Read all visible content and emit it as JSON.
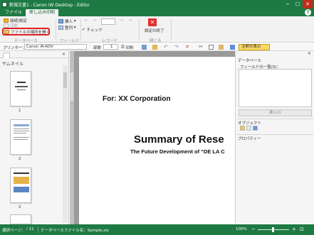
{
  "window": {
    "title": "新規文書1 - Canon iW Desktop - Editor",
    "controls": [
      "─",
      "☐",
      "✕"
    ]
  },
  "ribbon_tabs": [
    {
      "label": "ファイル",
      "active": false
    },
    {
      "label": "差し込み印刷",
      "active": true
    }
  ],
  "ribbon": {
    "connect_label": "接続/設定",
    "print_label": "印刷",
    "open_file_location_label": "ファイルの場所を開く",
    "group_dataset_label": "データベース",
    "insert_label": "挿入",
    "delete_label": "整列",
    "group_field_label": "フィールド",
    "check_label": "チェック",
    "group_record_label": "レコード",
    "close_settings_label": "設定の終了",
    "group_close_label": "閉じる"
  },
  "toolbar2": {
    "printer_label": "プリンター：",
    "printer_value": "Canon iR-ADV",
    "copies_label": "部数",
    "copies_value": "1",
    "print_button_label": "印刷",
    "properties_button_label": "注釈の表示"
  },
  "left_pane": {
    "tab_label": "サムネイル",
    "thumbnails": [
      {
        "number": "1"
      },
      {
        "number": "2"
      },
      {
        "number": "2"
      }
    ]
  },
  "document": {
    "company": "For: XX Corporation",
    "title": "Summary of Rese",
    "subtitle": "The Future Development of “DE LA C"
  },
  "right_pane": {
    "database_label": "データベース",
    "field_list_label": "フィールドの一覧(S)：",
    "insert_button_label": "挿入(I)",
    "objects_label": "オブジェクト",
    "properties_label": "プロパティー"
  },
  "statusbar": {
    "page_label": "選択ページ：",
    "page_value": "/ 11",
    "datasource_label": "データベースファイル名：Sample.xls",
    "zoom_value": "100%"
  },
  "colors": {
    "brand_green": "#1e7a43",
    "highlight_red": "#e02020",
    "props_yellow": "#ffd966"
  }
}
